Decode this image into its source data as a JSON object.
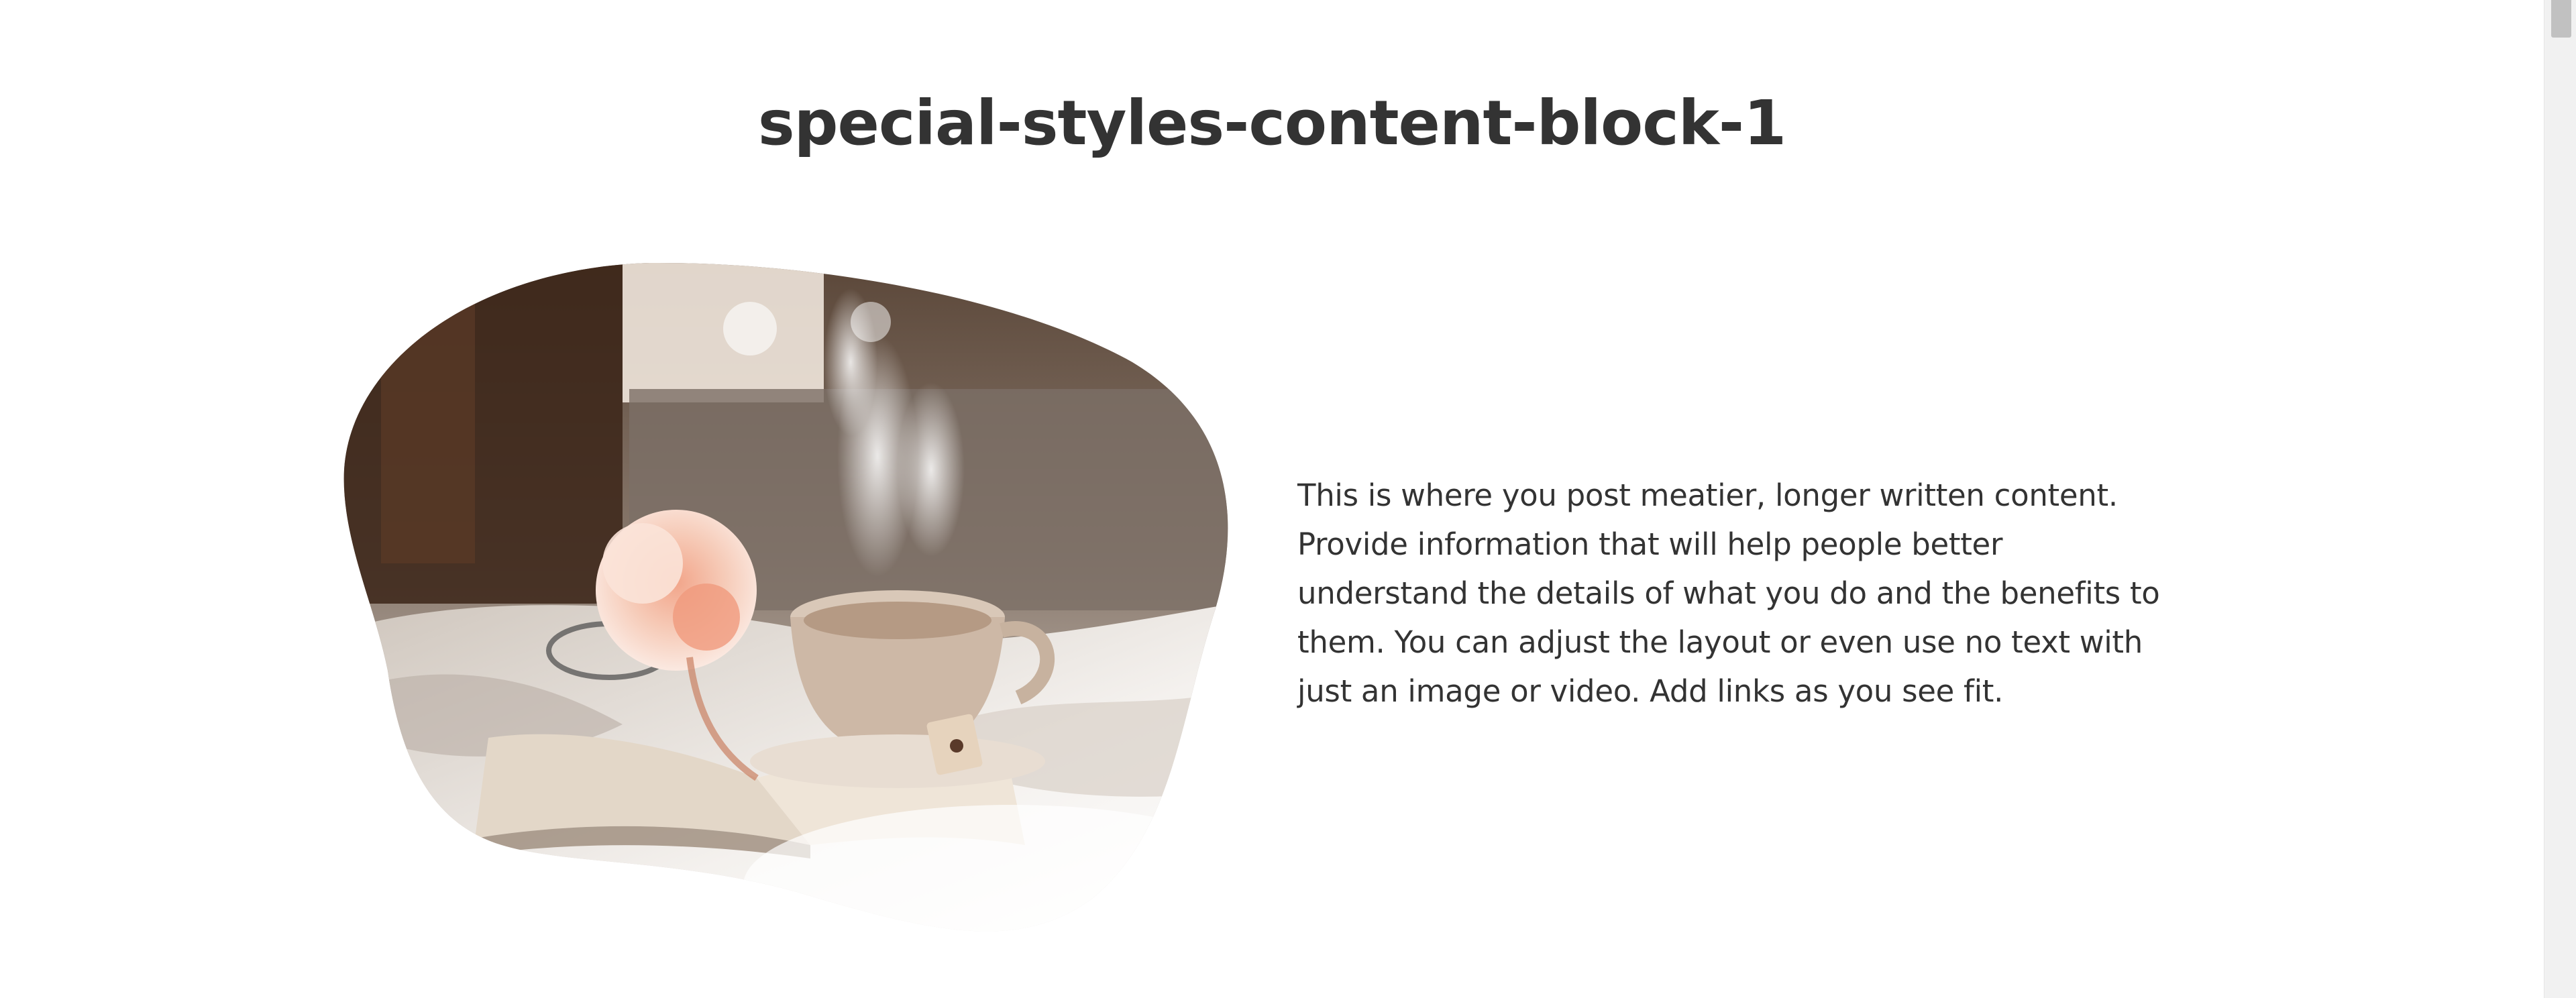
{
  "page": {
    "title": "special-styles-content-block-1"
  },
  "content_block": {
    "image": {
      "description_icon": "photo-teacup-book-flower",
      "alt": ""
    },
    "body_text": "This is where you post meatier, longer written content. Provide information that will help people better understand the details of what you do and the benefits to them. You can adjust the layout or even use no text with just an image or video. Add links as you see fit."
  },
  "colors": {
    "background": "#ffffff",
    "text": "#333333",
    "scrollbar_track": "#f1f1f1",
    "scrollbar_thumb": "#c1c1c1"
  },
  "scrollbar": {
    "position": 0
  }
}
